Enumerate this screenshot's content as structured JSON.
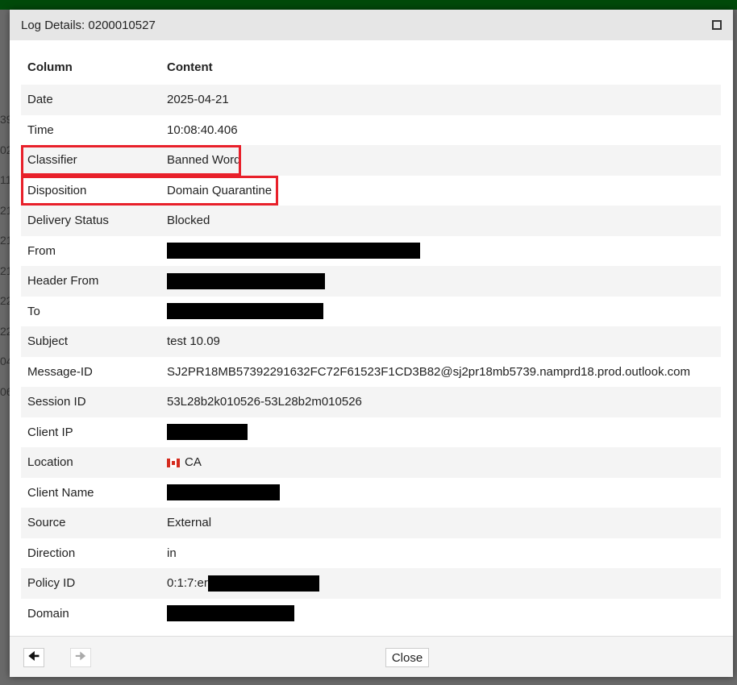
{
  "modal": {
    "title": "Log Details: 0200010527",
    "columns": {
      "key": "Column",
      "value": "Content"
    },
    "rows": [
      {
        "key": "Date",
        "value": "2025-04-21"
      },
      {
        "key": "Time",
        "value": "10:08:40.406"
      },
      {
        "key": "Classifier",
        "value": "Banned Word"
      },
      {
        "key": "Disposition",
        "value": "Domain Quarantine"
      },
      {
        "key": "Delivery Status",
        "value": "Blocked"
      },
      {
        "key": "From",
        "value": ""
      },
      {
        "key": "Header From",
        "value": ""
      },
      {
        "key": "To",
        "value": ""
      },
      {
        "key": "Subject",
        "value": "test 10.09"
      },
      {
        "key": "Message-ID",
        "value": "SJ2PR18MB57392291632FC72F61523F1CD3B82@sj2pr18mb5739.namprd18.prod.outlook.com"
      },
      {
        "key": "Session ID",
        "value": "53L28b2k010526-53L28b2m010526"
      },
      {
        "key": "Client IP",
        "value": ""
      },
      {
        "key": "Location",
        "value": "CA"
      },
      {
        "key": "Client Name",
        "value": ""
      },
      {
        "key": "Source",
        "value": "External"
      },
      {
        "key": "Direction",
        "value": "in"
      },
      {
        "key": "Policy ID",
        "value": "0:1:7:er"
      },
      {
        "key": "Domain",
        "value": ""
      }
    ],
    "footer": {
      "close_label": "Close"
    }
  },
  "background": {
    "row_fragments": [
      "39",
      "02",
      "11",
      "21",
      "21",
      "21",
      "22",
      "22",
      "04",
      "06"
    ]
  }
}
